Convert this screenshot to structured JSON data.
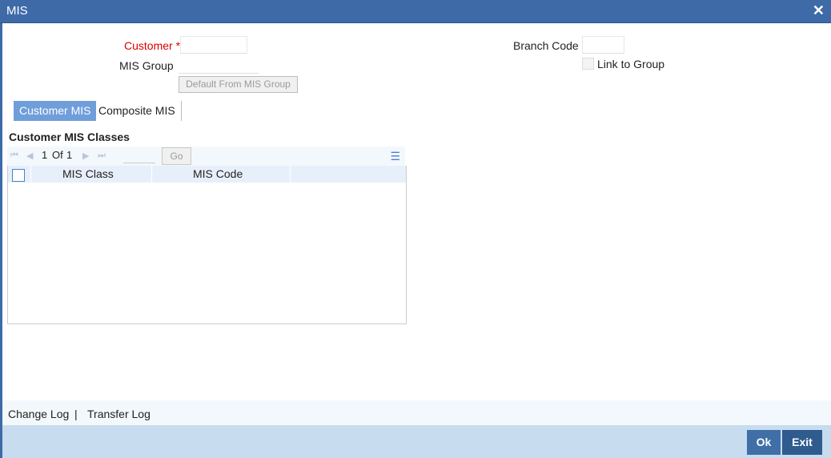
{
  "window": {
    "title": "MIS"
  },
  "header": {
    "customer_label": "Customer",
    "required_mark": "*",
    "mis_group_label": "MIS Group",
    "default_button": "Default From MIS Group",
    "branch_code_label": "Branch Code",
    "link_to_group_label": "Link to Group"
  },
  "tabs": [
    {
      "label": "Customer MIS"
    },
    {
      "label": "Composite MIS"
    }
  ],
  "section": {
    "title": "Customer MIS Classes"
  },
  "pager": {
    "current": "1",
    "of_label": "Of",
    "total": "1",
    "go_label": "Go"
  },
  "grid": {
    "columns": [
      "MIS Class",
      "MIS Code"
    ]
  },
  "footer": {
    "change_log": "Change Log",
    "separator": "|",
    "transfer_log": "Transfer Log",
    "ok": "Ok",
    "exit": "Exit"
  },
  "colors": {
    "titlebar": "#3e6aa8",
    "active_tab": "#6f9edb",
    "button": "#3f6fa6",
    "required": "#dd0000"
  }
}
